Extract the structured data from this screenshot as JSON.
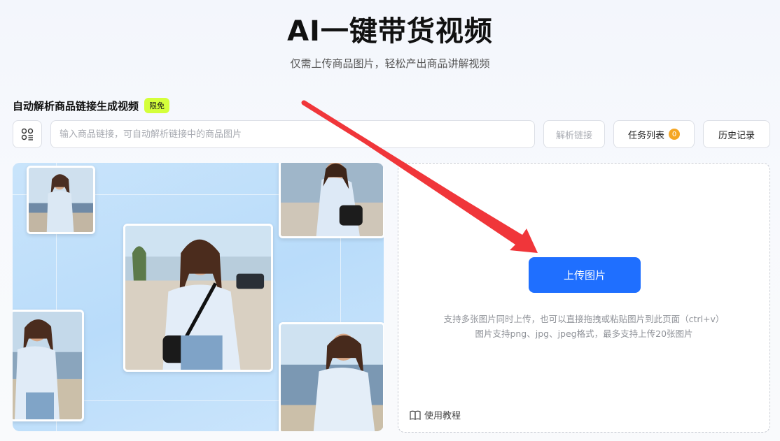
{
  "header": {
    "title": "AI一键带货视频",
    "subtitle": "仅需上传商品图片，轻松产出商品讲解视频"
  },
  "link_section": {
    "label": "自动解析商品链接生成视频",
    "badge": "限免",
    "input_placeholder": "输入商品链接，可自动解析链接中的商品图片",
    "input_value": "",
    "parse_label": "解析链接",
    "task_label": "任务列表",
    "task_count": "0",
    "history_label": "历史记录"
  },
  "upload": {
    "button_label": "上传图片",
    "hint_line1": "支持多张图片同时上传，也可以直接拖拽或粘贴图片到此页面（ctrl+v）",
    "hint_line2": "图片支持png、jpg、jpeg格式，最多支持上传20张图片",
    "tutorial_label": "使用教程"
  },
  "colors": {
    "accent": "#1f6fff",
    "badge": "#d4ff3a",
    "arrow": "#f0363a",
    "count_badge": "#f5a623"
  },
  "icons": {
    "link_tool": "apps-grid-icon",
    "tutorial": "book-icon"
  }
}
